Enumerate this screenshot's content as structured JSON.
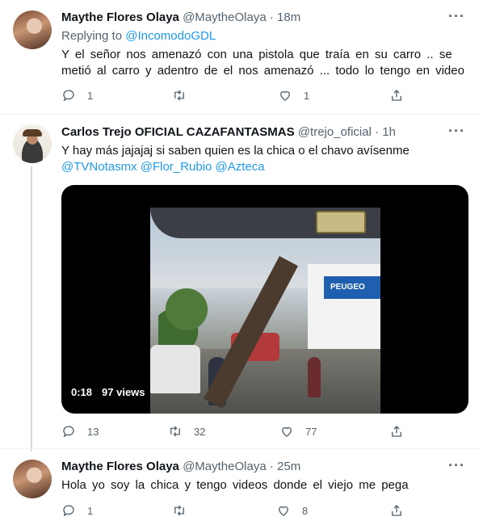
{
  "tweets": [
    {
      "name": "Maythe Flores Olaya",
      "handle": "@MaytheOlaya",
      "time": "· 18m",
      "replying_prefix": "Replying to ",
      "replying_to": "@IncomodoGDL",
      "text": "Y el señor nos amenazó con una pistola que traía en su carro .. se metió al carro y adentro de el nos amenazó ... todo lo tengo en video",
      "replies": "1",
      "retweets": "",
      "likes": "1"
    },
    {
      "name": "Carlos Trejo OFICIAL CAZAFANTASMAS",
      "handle": "@trejo_oficial",
      "time": "· 1h",
      "text": "Y hay más jajajaj si saben quien es la chica o el chavo avísenme",
      "mentions": "@TVNotasmx @Flor_Rubio @Azteca",
      "video_time": "0:18",
      "video_views": "97 views",
      "video_sign": "PEUGEO",
      "replies": "13",
      "retweets": "32",
      "likes": "77"
    },
    {
      "name": "Maythe Flores Olaya",
      "handle": "@MaytheOlaya",
      "time": "· 25m",
      "text": "Hola yo soy la chica y tengo videos donde el viejo me pega",
      "replies": "1",
      "retweets": "",
      "likes": "8"
    }
  ],
  "more_label": "···",
  "colors": {
    "link": "#1d9bf0",
    "muted": "#536471",
    "text": "#0f1419"
  },
  "icons": [
    "reply-icon",
    "retweet-icon",
    "like-icon",
    "share-icon",
    "more-icon"
  ]
}
